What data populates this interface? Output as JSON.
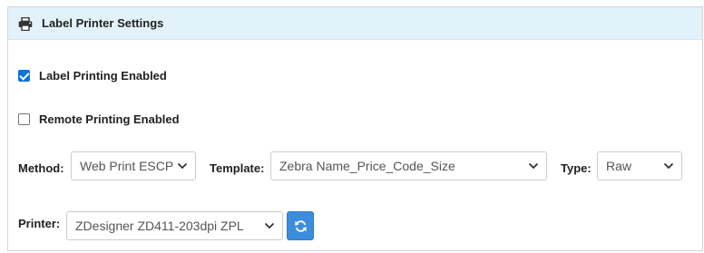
{
  "panel": {
    "title": "Label Printer Settings",
    "header_icon": "printer-icon"
  },
  "options": {
    "label_printing": {
      "label": "Label Printing Enabled",
      "checked": true
    },
    "remote_printing": {
      "label": "Remote Printing Enabled",
      "checked": false
    }
  },
  "method": {
    "label": "Method:",
    "value": "Web Print ESCP"
  },
  "template": {
    "label": "Template:",
    "value": "Zebra Name_Price_Code_Size"
  },
  "type": {
    "label": "Type:",
    "value": "Raw"
  },
  "printer": {
    "label": "Printer:",
    "value": "ZDesigner ZD411-203dpi ZPL",
    "refresh_icon": "refresh-icon"
  },
  "colors": {
    "header_bg": "#e2f2fb",
    "accent": "#3c8dde",
    "checkbox": "#0b74de"
  }
}
